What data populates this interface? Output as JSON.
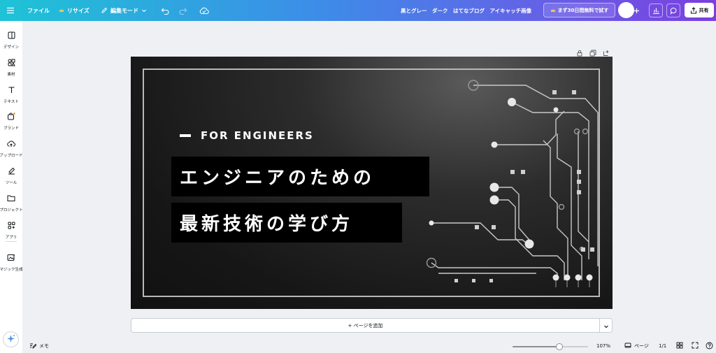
{
  "toolbar": {
    "menu_icon": "hamburger-icon",
    "file_label": "ファイル",
    "resize_label": "リサイズ",
    "edit_mode_label": "編集モード",
    "design_title": "黒とグレー　ダーク　はてなブログ　アイキャッチ画像",
    "promo_label": "まず30日間無料で試す",
    "share_label": "共有"
  },
  "sidebar": {
    "items": [
      {
        "label": "デザイン",
        "icon": "layout-icon"
      },
      {
        "label": "素材",
        "icon": "elements-icon"
      },
      {
        "label": "テキスト",
        "icon": "text-icon"
      },
      {
        "label": "ブランド",
        "icon": "brand-icon"
      },
      {
        "label": "アップロード",
        "icon": "upload-icon"
      },
      {
        "label": "ツール",
        "icon": "draw-icon"
      },
      {
        "label": "プロジェクト",
        "icon": "folder-icon"
      },
      {
        "label": "アプリ",
        "icon": "apps-icon"
      },
      {
        "label": "マジック生成",
        "icon": "magic-media-icon"
      }
    ]
  },
  "design": {
    "subtitle": "FOR ENGINEERS",
    "title_line1": "エンジニアのための",
    "title_line2": "最新技術の学び方"
  },
  "canvas": {
    "add_page_label": "+ ページを追加"
  },
  "bottom": {
    "notes_label": "メモ",
    "zoom": "107%",
    "zoom_fraction": 0.62,
    "pages_label": "ページ",
    "page_count": "1/1"
  },
  "colors": {
    "accent": "#7d2ae8",
    "teal": "#1ec3d6",
    "canvas_bg": "#1b1b1b",
    "frame": "#b8b8b8"
  }
}
